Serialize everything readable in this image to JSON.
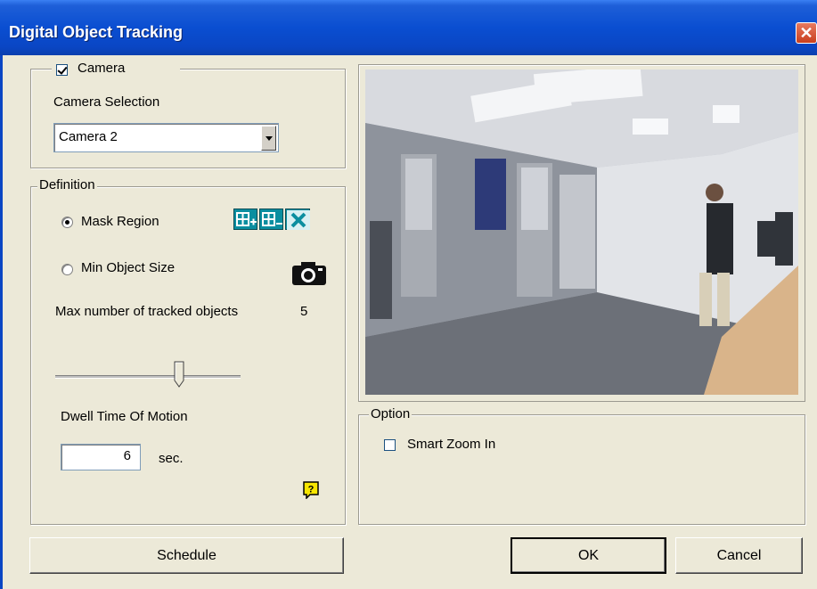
{
  "window": {
    "title": "Digital Object Tracking",
    "close_icon": "close-icon"
  },
  "camera": {
    "checkbox_label": "Camera",
    "checked": true,
    "selection_label": "Camera Selection",
    "selected": "Camera 2"
  },
  "definition": {
    "legend": "Definition",
    "mask_region_label": "Mask Region",
    "min_object_size_label": "Min Object Size",
    "selected_mode": "mask-region",
    "tools": [
      "add-region-icon",
      "remove-region-icon",
      "clear-regions-icon"
    ],
    "snapshot_icon": "camera-icon",
    "max_tracked_label": "Max number of tracked objects",
    "max_tracked_value": "5",
    "max_tracked_slider_fraction": 0.68,
    "dwell_label": "Dwell Time Of Motion",
    "dwell_value": "6",
    "dwell_unit": "sec.",
    "help_icon": "help-icon"
  },
  "option": {
    "legend": "Option",
    "smart_zoom_label": "Smart Zoom In",
    "smart_zoom_checked": false
  },
  "buttons": {
    "schedule": "Schedule",
    "ok": "OK",
    "cancel": "Cancel"
  },
  "colors": {
    "titlebar": "#0a46c4",
    "dialog_bg": "#ece9d8",
    "tool_button": "#0b8ea0",
    "help_icon": "#f7e600"
  }
}
